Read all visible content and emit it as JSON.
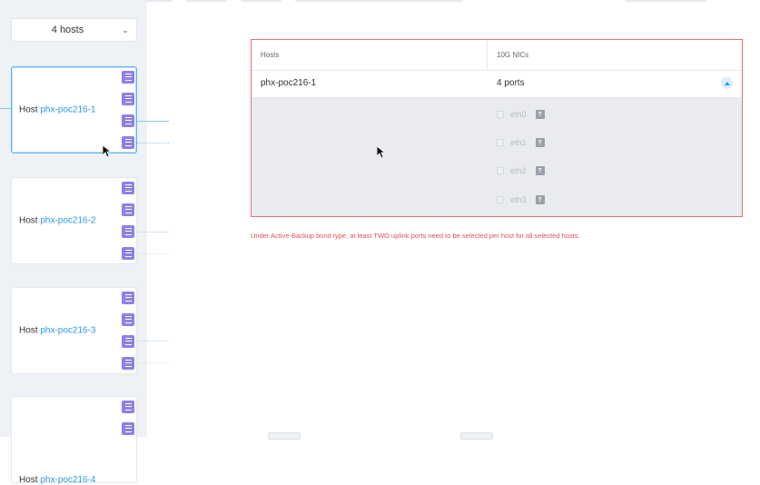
{
  "hosts_filter": {
    "selected": "4 hosts"
  },
  "host_prefix": "Host",
  "hosts": [
    {
      "name": "phx-poc216-1"
    },
    {
      "name": "phx-poc216-2"
    },
    {
      "name": "phx-poc216-3"
    },
    {
      "name": "phx-poc216-4"
    }
  ],
  "table": {
    "headers": {
      "hosts": "Hosts",
      "nics": "10G NICs"
    },
    "row": {
      "host": "phx-poc216-1",
      "ports": "4 ports"
    },
    "interfaces": [
      {
        "label": "eth0",
        "help": "?"
      },
      {
        "label": "eth1",
        "help": "?"
      },
      {
        "label": "eth2",
        "help": "?"
      },
      {
        "label": "eth3",
        "help": "?"
      }
    ]
  },
  "error_message": "Under Active-Backup bond type, at least TWO uplink ports need to be selected per host for all selected hosts.",
  "colors": {
    "accent": "#2a9be8",
    "error": "#e05252",
    "port_icon": "#8f7fe6"
  }
}
